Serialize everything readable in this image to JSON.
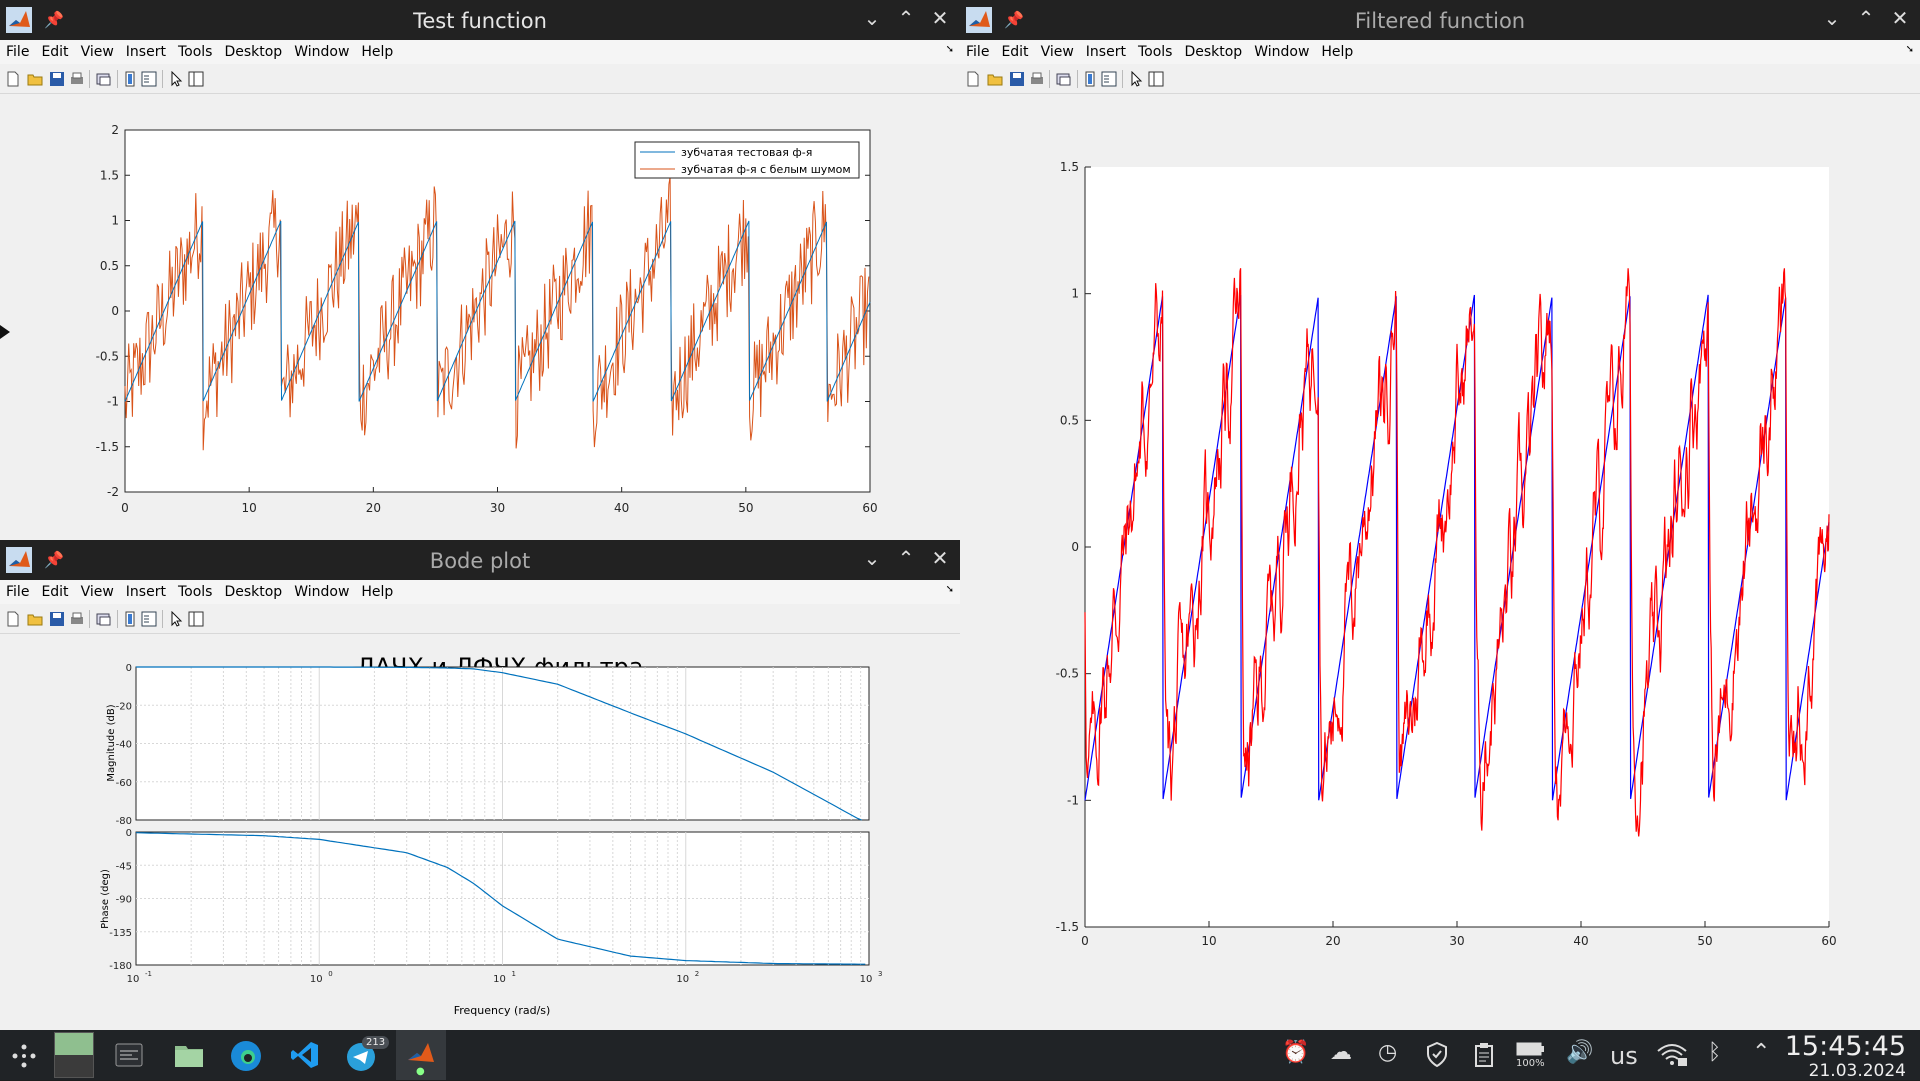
{
  "menus": [
    "File",
    "Edit",
    "View",
    "Insert",
    "Tools",
    "Desktop",
    "Window",
    "Help"
  ],
  "windows": {
    "test": {
      "title": "Test function"
    },
    "bode": {
      "title": "Bode plot"
    },
    "filtered": {
      "title": "Filtered function"
    }
  },
  "test_ticks": {
    "x": [
      "0",
      "10",
      "20",
      "30",
      "40",
      "50",
      "60"
    ],
    "y": [
      "2",
      "1.5",
      "1",
      "0.5",
      "0",
      "-0.5",
      "-1",
      "-1.5",
      "-2"
    ]
  },
  "filt_ticks": {
    "x": [
      "0",
      "10",
      "20",
      "30",
      "40",
      "50",
      "60"
    ],
    "y": [
      "1.5",
      "1",
      "0.5",
      "0",
      "-0.5",
      "-1",
      "-1.5"
    ]
  },
  "bode_labels": {
    "title": "ЛАЧХ и ЛФЧХ фильтра",
    "mag_ylabel": "Magnitude (dB)",
    "phase_ylabel": "Phase (deg)",
    "xlabel": "Frequency  (rad/s)",
    "mag_ticks": [
      "0",
      "-20",
      "-40",
      "-60",
      "-80"
    ],
    "phase_ticks": [
      "0",
      "-45",
      "-90",
      "-135",
      "-180"
    ],
    "x_ticks": [
      "10",
      "10",
      "10",
      "10"
    ],
    "x_exps": [
      "-1",
      "0",
      "1",
      "2",
      "3"
    ]
  },
  "chart_data": [
    {
      "type": "line",
      "title": "",
      "xlim": [
        0,
        60
      ],
      "ylim": [
        -2,
        2
      ],
      "legend": {
        "placement": "top-right"
      },
      "series": [
        {
          "name": "зубчатая тестовая ф-я",
          "color": "#0072bd",
          "kind": "sawtooth",
          "amplitude": 1,
          "period": 6.28
        },
        {
          "name": "зубчатая ф-я с белым шумом",
          "color": "#d95319",
          "kind": "sawtooth_plus_noise",
          "noise_range": 0.6
        }
      ]
    },
    {
      "type": "line",
      "title": "ЛАЧХ и ЛФЧХ фильтра",
      "xscale": "log",
      "xlim": [
        0.1,
        1000
      ],
      "subplots": [
        {
          "name": "Magnitude (dB)",
          "ylim": [
            -80,
            0
          ],
          "x": [
            0.1,
            1,
            3,
            5,
            7,
            10,
            20,
            50,
            100,
            300,
            900
          ],
          "y": [
            0,
            0,
            -0.2,
            -0.5,
            -1,
            -3,
            -9,
            -24,
            -35,
            -55,
            -80
          ]
        },
        {
          "name": "Phase (deg)",
          "ylim": [
            -180,
            0
          ],
          "x": [
            0.1,
            0.5,
            1,
            3,
            5,
            7,
            10,
            20,
            50,
            100,
            300,
            1000
          ],
          "y": [
            -1,
            -5,
            -10,
            -28,
            -48,
            -70,
            -100,
            -145,
            -168,
            -174,
            -178,
            -179
          ]
        }
      ],
      "color": "#0072bd"
    },
    {
      "type": "line",
      "title": "",
      "xlim": [
        0,
        60
      ],
      "ylim": [
        -1.5,
        1.5
      ],
      "series": [
        {
          "color": "#0000ff",
          "kind": "sawtooth",
          "amplitude": 1,
          "period": 6.28
        },
        {
          "color": "#ff0000",
          "kind": "filtered_sawtooth"
        }
      ]
    }
  ],
  "taskbar": {
    "badge": "213",
    "kbd": "us",
    "battery": "100%",
    "time": "15:45:45",
    "date": "21.03.2024"
  }
}
